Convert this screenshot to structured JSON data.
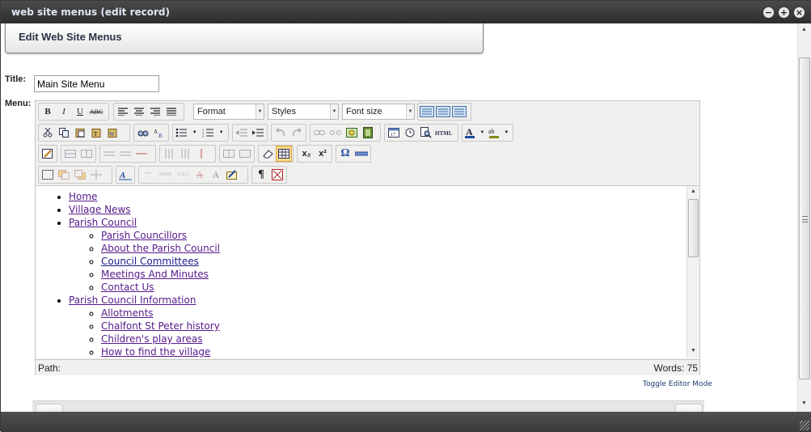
{
  "window": {
    "title": "web site menus (edit record)",
    "controls": [
      "−",
      "+",
      "×"
    ]
  },
  "header": {
    "title": "Edit Web Site Menus"
  },
  "form": {
    "title_label": "Title:",
    "title_value": "Main Site Menu",
    "menu_label": "Menu:"
  },
  "toolbar": {
    "format_label": "Format",
    "styles_label": "Styles",
    "fontsize_label": "Font size",
    "row1": {
      "bold": "B",
      "italic": "I",
      "underline": "U",
      "strike": "ABC"
    },
    "row3": {
      "subscript": "x₂",
      "superscript": "x²",
      "omega": "Ω"
    },
    "row4": {
      "pilcrow": "¶"
    }
  },
  "menu_tree": [
    {
      "label": "Home",
      "children": []
    },
    {
      "label": "Village News",
      "children": []
    },
    {
      "label": "Parish Council",
      "children": [
        "Parish Councillors",
        "About the Parish Council",
        "Council Committees",
        "Meetings And Minutes",
        "Contact Us"
      ]
    },
    {
      "label": "Parish Council Information",
      "children": [
        "Allotments",
        "Chalfont St Peter history",
        "Children's play areas",
        "How to find the village"
      ]
    }
  ],
  "editor_status": {
    "path_label": "Path:",
    "words": "Words: 75"
  },
  "toggle_mode_label": "Toggle Editor Mode"
}
